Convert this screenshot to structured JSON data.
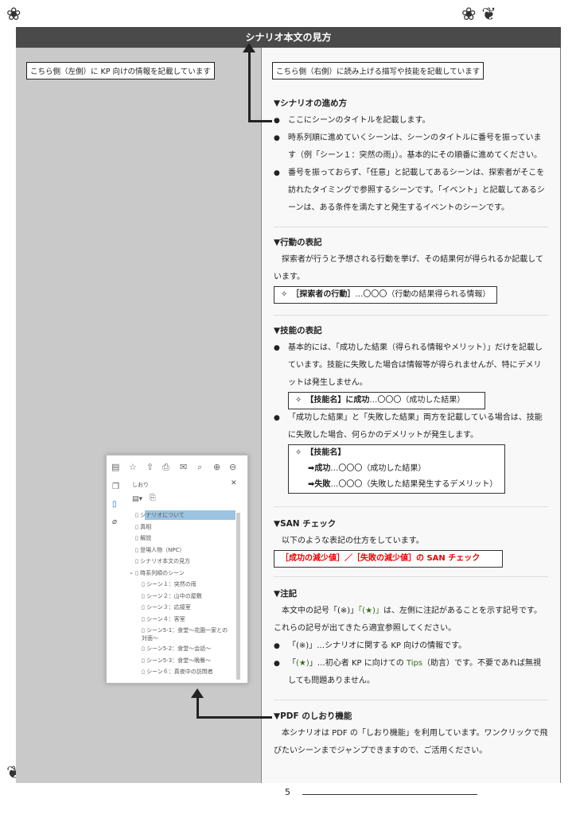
{
  "header": {
    "title": "シナリオ本文の見方"
  },
  "left_label": "こちら側（左側）に KP 向けの情報を記載しています",
  "right_label": "こちら側（右側）に読み上げる描写や技能を記載しています",
  "sections": {
    "s1": {
      "heading": "▼シナリオの進め方",
      "b1": "ここにシーンのタイトルを記載します。",
      "b2": "時系列順に進めていくシーンは、シーンのタイトルに番号を振っています（例「シーン１：突然の雨」）。基本的にその順番に進めてください。",
      "b3": "番号を振っておらず、「任意」と記載してあるシーンは、探索者がそこを訪れたタイミングで参照するシーンです。「イベント」と記載してあるシーンは、ある条件を満たすと発生するイベントのシーンです。"
    },
    "s2": {
      "heading": "▼行動の表記",
      "p": "探索者が行うと予想される行動を挙げ、その結果何が得られるか記載しています。",
      "box_bold": "✧　［探索者の行動］",
      "box_rest": "…〇〇〇（行動の結果得られる情報）"
    },
    "s3": {
      "heading": "▼技能の表記",
      "b1": "基本的には、「成功した結果（得られる情報やメリット）」だけを記載しています。技能に失敗した場合は情報等が得られませんが、特にデメリットは発生しません。",
      "box1_bold": "✧　【技能名】に成功",
      "box1_rest": "…〇〇〇（成功した結果）",
      "b2": "「成功した結果」と「失敗した結果」両方を記載している場合は、技能に失敗した場合、何らかのデメリットが発生します。",
      "box2_title": "✧　【技能名】",
      "box2_success_bold": "➡成功",
      "box2_success_rest": "…〇〇〇（成功した結果）",
      "box2_fail_bold": "➡失敗",
      "box2_fail_rest": "…〇〇〇（失敗した結果発生するデメリット）"
    },
    "s4": {
      "heading": "▼SAN チェック",
      "p": "以下のような表記の仕方をしています。",
      "box": "［成功の減少値］／［失敗の減少値］の SAN チェック"
    },
    "s5": {
      "heading": "▼注記",
      "p_a": "本文中の記号「(※)」",
      "p_star": "「(★)」",
      "p_b": "は、左側に注記があることを示す記号です。これらの記号が出てきたら適宜参照してください。",
      "b1": "「(※)」…シナリオに関する KP 向けの情報です。",
      "b2_a": "「",
      "b2_star": "(★)",
      "b2_b": "」…初心者 KP に向けての ",
      "b2_tips": "Tips",
      "b2_c": "（助言）です。不要であれば無視しても問題ありません。"
    },
    "s6": {
      "heading": "▼PDF のしおり機能",
      "p": "本シナリオは PDF の「しおり機能」を利用しています。ワンクリックで飛びたいシーンまでジャンプできますので、ご活用ください。"
    }
  },
  "pdf_panel": {
    "title": "しおり",
    "close": "✕",
    "bookmarks": [
      "シナリオについて",
      "真相",
      "解説",
      "登場人物（NPC）",
      "シナリオ本文の見方",
      "時系列順のシーン",
      "シーン１：突然の雨",
      "シーン２：山中の屋敷",
      "シーン３：応接室",
      "シーン４：客室",
      "シーン5-1：食堂〜花園一家との対面〜",
      "シーン5-2：食堂〜会話〜",
      "シーン5-3：食堂〜晩餐〜",
      "シーン６：真夜中の訪問者"
    ]
  },
  "page_number": "5",
  "colors": {
    "header": "#4a4a4a",
    "left_panel": "#c9c9c9",
    "red": "#e00000",
    "green": "#3a6b1f",
    "highlight": "#9cc3e0"
  }
}
